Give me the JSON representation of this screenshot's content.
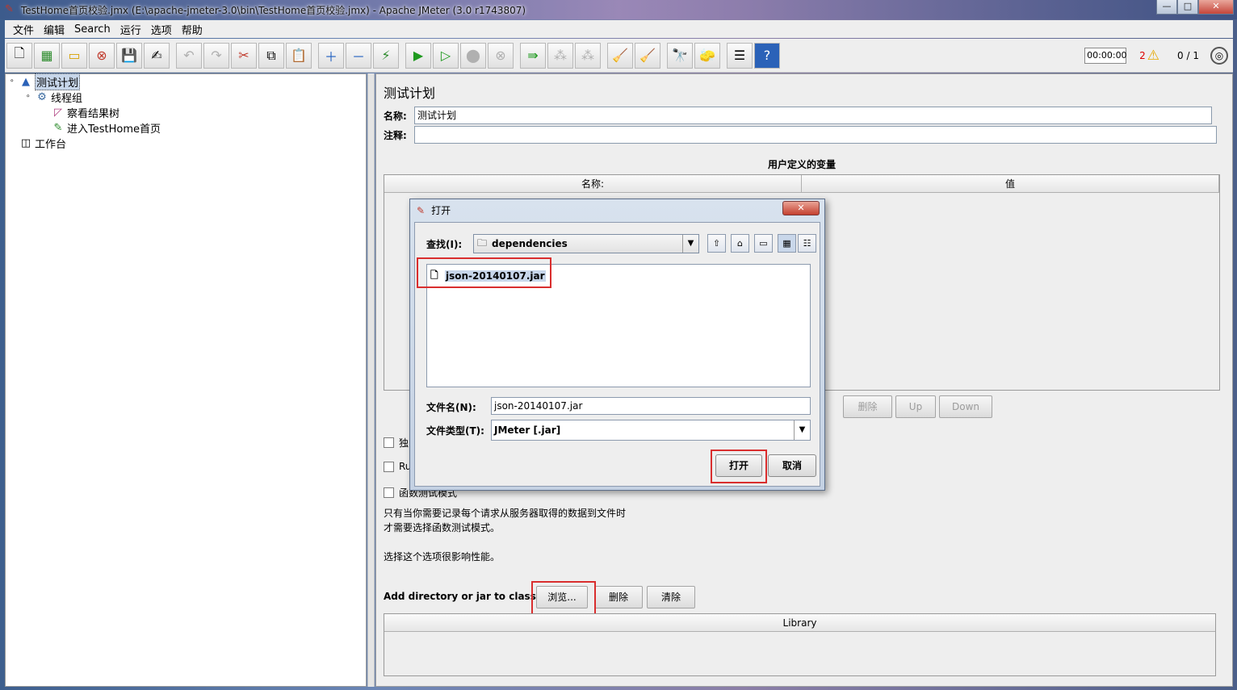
{
  "window": {
    "title": "TestHome首页校验.jmx (E:\\apache-jmeter-3.0\\bin\\TestHome首页校验.jmx) - Apache JMeter (3.0 r1743807)",
    "min_label": "—",
    "max_label": "□",
    "close_label": "✕"
  },
  "menu": [
    "文件",
    "编辑",
    "Search",
    "运行",
    "选项",
    "帮助"
  ],
  "toolbar": {
    "timer": "00:00:00",
    "warning_count": "2",
    "threads": "0 / 1"
  },
  "tree": {
    "root": "测试计划",
    "thread_group": "线程组",
    "listener": "察看结果树",
    "sampler": "进入TestHome首页",
    "workbench": "工作台"
  },
  "panel": {
    "title": "测试计划",
    "name_label": "名称:",
    "name_value": "测试计划",
    "comment_label": "注释:",
    "comment_value": "",
    "variables_title": "用户定义的变量",
    "col_name": "名称:",
    "col_value": "值",
    "btn_delete": "删除",
    "btn_up": "Up",
    "btn_down": "Down",
    "chk1_label": "独",
    "chk2_label": "Ru",
    "chk3_label": "函数测试模式",
    "note_line1": "只有当你需要记录每个请求从服务器取得的数据到文件时",
    "note_line2": "才需要选择函数测试模式。",
    "note_line3": "选择这个选项很影响性能。",
    "classpath_label": "Add directory or jar to classpath",
    "btn_browse": "浏览...",
    "btn_remove": "删除",
    "btn_clear": "清除",
    "library_header": "Library"
  },
  "dialog": {
    "title": "打开",
    "close_label": "✕",
    "lookin_label": "查找(I):",
    "lookin_value": "dependencies",
    "file_name": "json-20140107.jar",
    "filename_label": "文件名(N):",
    "filename_value": "json-20140107.jar",
    "filetype_label": "文件类型(T):",
    "filetype_value": "JMeter [.jar]",
    "btn_open": "打开",
    "btn_cancel": "取消"
  },
  "colors": {
    "highlight": "#d92e2e",
    "selection": "#c7d6ea"
  }
}
